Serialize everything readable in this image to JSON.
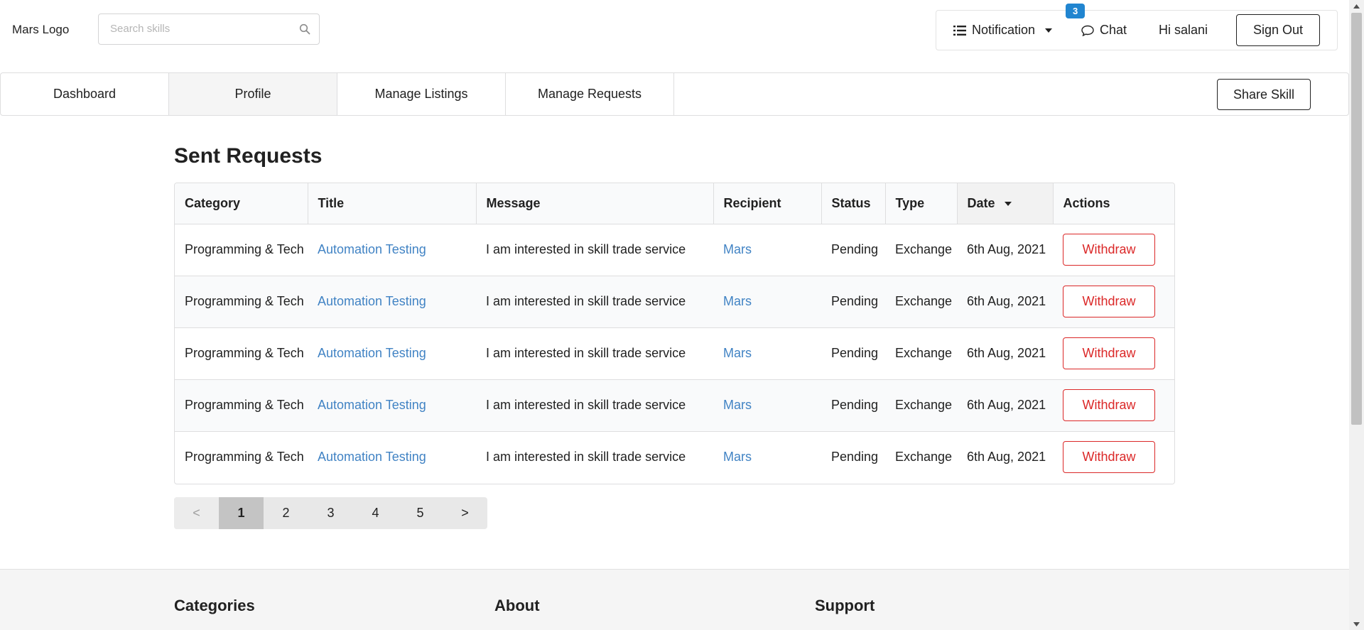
{
  "header": {
    "logo": "Mars Logo",
    "search_placeholder": "Search skills",
    "notification_label": "Notification",
    "notification_count": "3",
    "chat_label": "Chat",
    "greeting": "Hi salani",
    "signout_label": "Sign Out"
  },
  "nav": {
    "tabs": [
      {
        "label": "Dashboard"
      },
      {
        "label": "Profile"
      },
      {
        "label": "Manage Listings"
      },
      {
        "label": "Manage Requests"
      }
    ],
    "active_tab": "Profile",
    "share_label": "Share Skill"
  },
  "main": {
    "heading": "Sent Requests",
    "columns": [
      "Category",
      "Title",
      "Message",
      "Recipient",
      "Status",
      "Type",
      "Date",
      "Actions"
    ],
    "sorted_column": "Date",
    "rows": [
      {
        "category": "Programming & Tech",
        "title": "Automation Testing",
        "message": "I am interested in skill trade service",
        "recipient": "Mars",
        "status": "Pending",
        "type": "Exchange",
        "date": "6th Aug, 2021",
        "action": "Withdraw"
      },
      {
        "category": "Programming & Tech",
        "title": "Automation Testing",
        "message": "I am interested in skill trade service",
        "recipient": "Mars",
        "status": "Pending",
        "type": "Exchange",
        "date": "6th Aug, 2021",
        "action": "Withdraw"
      },
      {
        "category": "Programming & Tech",
        "title": "Automation Testing",
        "message": "I am interested in skill trade service",
        "recipient": "Mars",
        "status": "Pending",
        "type": "Exchange",
        "date": "6th Aug, 2021",
        "action": "Withdraw"
      },
      {
        "category": "Programming & Tech",
        "title": "Automation Testing",
        "message": "I am interested in skill trade service",
        "recipient": "Mars",
        "status": "Pending",
        "type": "Exchange",
        "date": "6th Aug, 2021",
        "action": "Withdraw"
      },
      {
        "category": "Programming & Tech",
        "title": "Automation Testing",
        "message": "I am interested in skill trade service",
        "recipient": "Mars",
        "status": "Pending",
        "type": "Exchange",
        "date": "6th Aug, 2021",
        "action": "Withdraw"
      }
    ],
    "pagination": {
      "prev": "<",
      "pages": [
        "1",
        "2",
        "3",
        "4",
        "5"
      ],
      "current": "1",
      "next": ">"
    }
  },
  "footer": {
    "columns": [
      "Categories",
      "About",
      "Support"
    ]
  },
  "colors": {
    "link": "#4183c4",
    "danger": "#db2828",
    "badge": "#2185d0"
  }
}
